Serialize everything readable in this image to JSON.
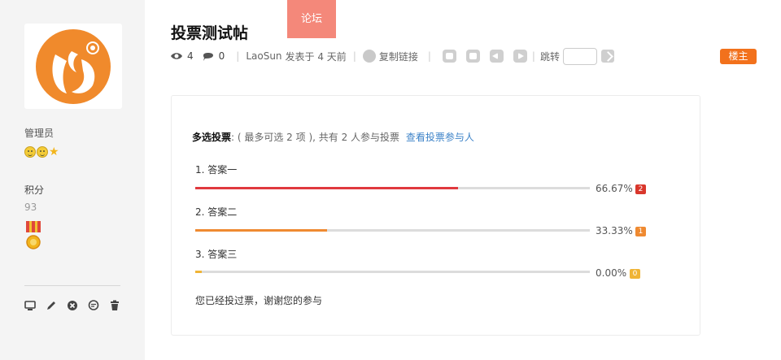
{
  "sidebar": {
    "group_name": "管理员",
    "credit_label": "积分",
    "credit_value": "93",
    "tool_icons": [
      "monitor-icon",
      "pencil-icon",
      "close-circle-icon",
      "chat-bubble-icon",
      "trash-icon"
    ]
  },
  "header": {
    "forum_tab": "论坛",
    "title": "投票测试帖",
    "views": "4",
    "replies": "0",
    "author": "LaoSun",
    "posted_text": "发表于 4 天前",
    "copy_link": "复制链接",
    "jump_label": "跳转",
    "owner_badge": "楼主"
  },
  "poll": {
    "type_label": "多选投票",
    "info": ": ( 最多可选 2 项 ), 共有 2 人参与投票",
    "view_voters": "查看投票参与人",
    "options": [
      {
        "label": "1.  答案一",
        "percent_text": "66.67%",
        "fraction": 0.6667,
        "count": "2",
        "color": "#e0393e",
        "badge_color": "#d9372c"
      },
      {
        "label": "2.  答案二",
        "percent_text": "33.33%",
        "fraction": 0.3333,
        "count": "1",
        "color": "#ef8a31",
        "badge_color": "#ef8a31"
      },
      {
        "label": "3.  答案三",
        "percent_text": "0.00%",
        "fraction": 0.0,
        "count": "0",
        "color": "#f0b436",
        "badge_color": "#f0b436"
      }
    ],
    "voted_message": "您已经投过票，谢谢您的参与"
  }
}
